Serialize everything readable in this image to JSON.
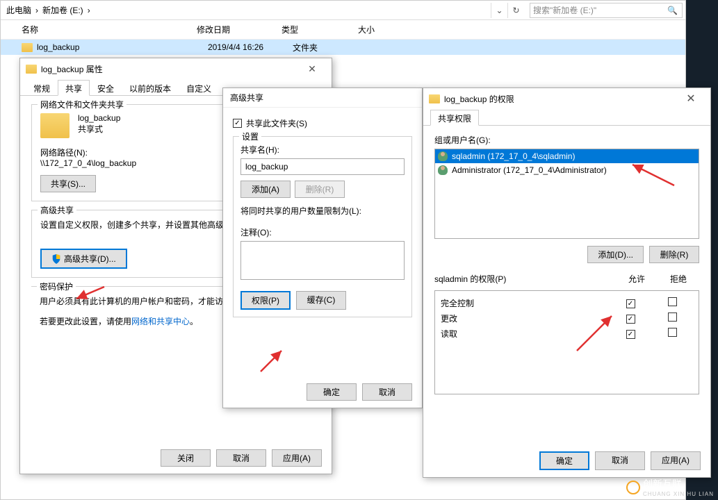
{
  "explorer": {
    "path_parts": [
      "此电脑",
      "新加卷 (E:)"
    ],
    "search_placeholder": "搜索\"新加卷 (E:)\"",
    "columns": {
      "name": "名称",
      "date": "修改日期",
      "type": "类型",
      "size": "大小"
    },
    "row": {
      "name": "log_backup",
      "date": "2019/4/4 16:26",
      "type": "文件夹"
    }
  },
  "props": {
    "title": "log_backup 属性",
    "tabs": [
      "常规",
      "共享",
      "安全",
      "以前的版本",
      "自定义"
    ],
    "group1_title": "网络文件和文件夹共享",
    "folder_name": "log_backup",
    "share_status": "共享式",
    "net_path_label": "网络路径(N):",
    "net_path": "\\\\172_17_0_4\\log_backup",
    "share_btn": "共享(S)...",
    "group2_title": "高级共享",
    "adv_desc": "设置自定义权限，创建多个共享，并设置其他高级共享选项。",
    "adv_btn": "高级共享(D)...",
    "group3_title": "密码保护",
    "pwd_desc": "用户必须具有此计算机的用户帐户和密码，才能访问共享文件夹。",
    "pwd_link_prefix": "若要更改此设置，请使用",
    "pwd_link": "网络和共享中心",
    "footer": {
      "close": "关闭",
      "cancel": "取消",
      "apply": "应用(A)"
    }
  },
  "adv": {
    "title": "高级共享",
    "share_checkbox": "共享此文件夹(S)",
    "settings_title": "设置",
    "share_name_label": "共享名(H):",
    "share_name": "log_backup",
    "add_btn": "添加(A)",
    "del_btn": "删除(R)",
    "limit_label": "将同时共享的用户数量限制为(L):",
    "note_label": "注释(O):",
    "perm_btn": "权限(P)",
    "cache_btn": "缓存(C)",
    "footer": {
      "ok": "确定",
      "cancel": "取消"
    }
  },
  "perm": {
    "title": "log_backup 的权限",
    "tab": "共享权限",
    "users_label": "组或用户名(G):",
    "users": [
      {
        "name": "sqladmin (172_17_0_4\\sqladmin)",
        "selected": true
      },
      {
        "name": "Administrator (172_17_0_4\\Administrator)",
        "selected": false
      }
    ],
    "add_btn": "添加(D)...",
    "del_btn": "删除(R)",
    "perm_for": "sqladmin 的权限(P)",
    "allow": "允许",
    "deny": "拒绝",
    "rows": [
      {
        "name": "完全控制",
        "allow": true,
        "deny": false
      },
      {
        "name": "更改",
        "allow": true,
        "deny": false
      },
      {
        "name": "读取",
        "allow": true,
        "deny": false
      }
    ],
    "footer": {
      "ok": "确定",
      "cancel": "取消",
      "apply": "应用(A)"
    }
  },
  "watermark": {
    "text": "创新互联",
    "sub": "CHUANG XIN HU LIAN"
  }
}
